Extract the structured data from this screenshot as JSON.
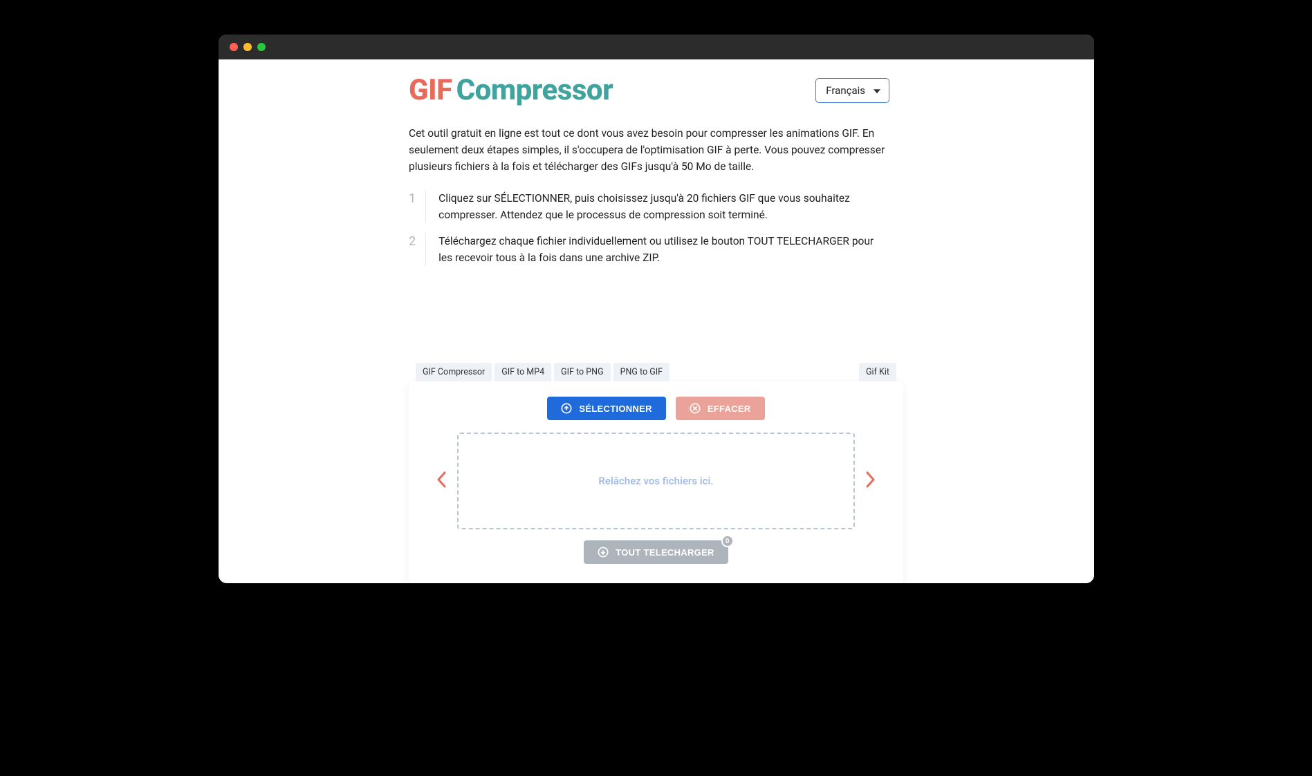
{
  "logo": {
    "part1": "GIF",
    "part2": "Compressor"
  },
  "language": {
    "selected": "Français"
  },
  "description": "Cet outil gratuit en ligne est tout ce dont vous avez besoin pour compresser les animations GIF. En seulement deux étapes simples, il s'occupera de l'optimisation GIF à perte. Vous pouvez compresser plusieurs fichiers à la fois et télécharger des GIFs jusqu'à 50 Mo de taille.",
  "steps": [
    {
      "num": "1",
      "text": "Cliquez sur SÉLECTIONNER, puis choisissez jusqu'à 20 fichiers GIF que vous souhaitez compresser. Attendez que le processus de compression soit terminé."
    },
    {
      "num": "2",
      "text": "Téléchargez chaque fichier individuellement ou utilisez le bouton TOUT TELECHARGER pour les recevoir tous à la fois dans une archive ZIP."
    }
  ],
  "tabs": {
    "left": [
      "GIF Compressor",
      "GIF to MP4",
      "GIF to PNG",
      "PNG to GIF"
    ],
    "right": "Gif Kit"
  },
  "buttons": {
    "select": "SÉLECTIONNER",
    "clear": "EFFACER",
    "download_all": "TOUT TELECHARGER",
    "badge_count": "0"
  },
  "dropzone": {
    "text": "Relâchez vos fichiers ici."
  }
}
